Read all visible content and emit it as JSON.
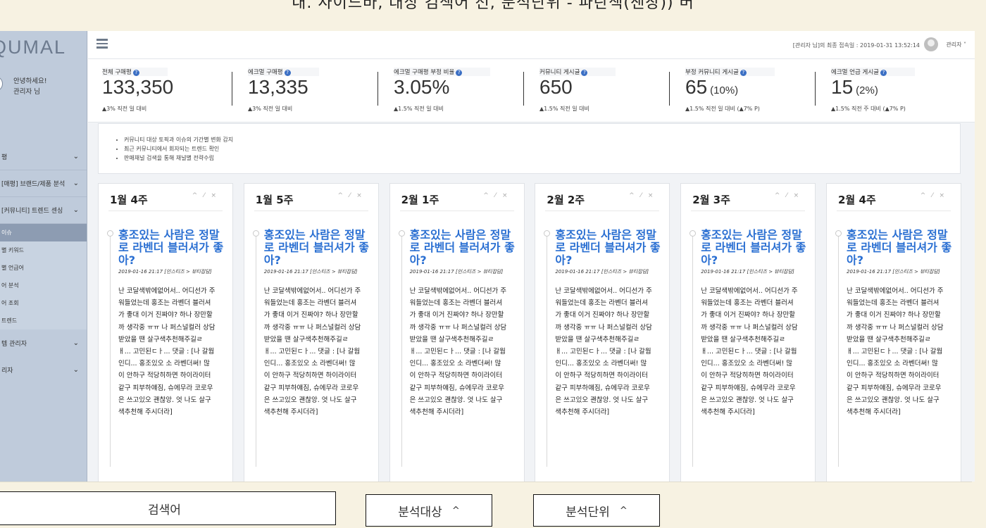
{
  "caption": "내. 사이드바, 대상 검색어 선, 분석단위 - 파란색(샌창)) 버",
  "sidebar": {
    "logo": "QUMAL",
    "greeting_line1": "안녕하세요!",
    "greeting_line2": "관리자 님",
    "menu": [
      {
        "label": "평"
      },
      {
        "label": "[매평] 브랜드/제품 분석"
      },
      {
        "label": "[커뮤니티] 트렌드 센싱"
      }
    ],
    "submenu": [
      "이슈",
      "별 키워드",
      "별 언급어",
      "어 분석",
      "어 조회",
      "트렌드"
    ],
    "menu_tail": [
      {
        "label": "템 관리자"
      },
      {
        "label": "리자"
      }
    ]
  },
  "topbar": {
    "last_login": "[관리자 님]의 최종 접속일 : 2019-01-31 13:52:14",
    "admin": "관리자 ˅"
  },
  "stats": [
    {
      "label": "전체 구매평",
      "value": "133,350",
      "pct": "",
      "sub": "▲3% 직전 일 대비"
    },
    {
      "label": "에크멀 구매평",
      "value": "13,335",
      "pct": "",
      "sub": "▲3% 직전 일 대비"
    },
    {
      "label": "에크멀 구매평 부정 비율",
      "value": "3.05%",
      "pct": "",
      "sub": "▲1.5% 직전 일 대비"
    },
    {
      "label": "커뮤니티 게시글",
      "value": "650",
      "pct": "",
      "sub": "▲1.5% 직전 일 대비"
    },
    {
      "label": "부정 커뮤니티 게시글",
      "value": "65",
      "pct": "(10%)",
      "sub": "▲1.5% 직전 일 대비 (▲7% P)"
    },
    {
      "label": "에크멀 언급 게시글",
      "value": "15",
      "pct": "(2%)",
      "sub": "▲1.5% 직전 주 대비 (▲7% P)"
    }
  ],
  "info": [
    "커뮤니티 대상 토픽과 이슈의 기간별 변화 감지",
    "최근 커뮤니티에서 회자되는 트렌드 확인",
    "판매채널 검색을 통해 채널별 전략수립"
  ],
  "card_tools": "^ ⁄ ×",
  "cards": [
    {
      "title": "1월 4주",
      "post_title": "홍조있는 사람은 정말로 라벤더 블러셔가 좋아?",
      "meta": "2019-01-16 21:17 [인스티즈 > 뷰티잡담]",
      "body": "난 코달색밖에없어서.. 어디선가 주워들었는데 홍조는 라벤더 블러셔가 좋대 이거 진짜야? 하나 장만할까 생각중 ㅠㅠ 나 퍼스널컬러 상담받았을 땐 살구색추천해주길ㄹ ㅐ... 고민된ㄷㅏ... 댓글 : [나 갈웜인디... 홍조있오 소 라벤더써! 많이 안하구 적당히하면 하이라이터 같구 피부하얘짐, 슈에무라 코로우은 쓰고있오 괜찮앙. 엇 나도 살구색추천해 주시더라]"
    },
    {
      "title": "1월 5주",
      "post_title": "홍조있는 사람은 정말로 라벤더 블러셔가 좋아?",
      "meta": "2019-01-16 21:17 [인스티즈 > 뷰티잡담]",
      "body": "난 코달색밖에없어서.. 어디선가 주워들었는데 홍조는 라벤더 블러셔가 좋대 이거 진짜야? 하나 장만할까 생각중 ㅠㅠ 나 퍼스널컬러 상담받았을 땐 살구색추천해주길ㄹ ㅐ... 고민된ㄷㅏ... 댓글 : [나 갈웜인디... 홍조있오 소 라벤더써! 많이 안하구 적당히하면 하이라이터 같구 피부하얘짐, 슈에무라 코로우은 쓰고있오 괜찮앙. 엇 나도 살구색추천해 주시더라]"
    },
    {
      "title": "2월 1주",
      "post_title": "홍조있는 사람은 정말로 라벤더 블러셔가 좋아?",
      "meta": "2019-01-16 21:17 [인스티즈 > 뷰티잡담]",
      "body": "난 코달색밖에없어서.. 어디선가 주워들었는데 홍조는 라벤더 블러셔가 좋대 이거 진짜야? 하나 장만할까 생각중 ㅠㅠ 나 퍼스널컬러 상담받았을 땐 살구색추천해주길ㄹ ㅐ... 고민된ㄷㅏ... 댓글 : [나 갈웜인디... 홍조있오 소 라벤더써! 많이 안하구 적당히하면 하이라이터 같구 피부하얘짐, 슈에무라 코로우은 쓰고있오 괜찮앙. 엇 나도 살구색추천해 주시더라]"
    },
    {
      "title": "2월 2주",
      "post_title": "홍조있는 사람은 정말로 라벤더 블러셔가 좋아?",
      "meta": "2019-01-16 21:17 [인스티즈 > 뷰티잡담]",
      "body": "난 코달색밖에없어서.. 어디선가 주워들었는데 홍조는 라벤더 블러셔가 좋대 이거 진짜야? 하나 장만할까 생각중 ㅠㅠ 나 퍼스널컬러 상담받았을 땐 살구색추천해주길ㄹ ㅐ... 고민된ㄷㅏ... 댓글 : [나 갈웜인디... 홍조있오 소 라벤더써! 많이 안하구 적당히하면 하이라이터 같구 피부하얘짐, 슈에무라 코로우은 쓰고있오 괜찮앙. 엇 나도 살구색추천해 주시더라]"
    },
    {
      "title": "2월 3주",
      "post_title": "홍조있는 사람은 정말로 라벤더 블러셔가 좋아?",
      "meta": "2019-01-16 21:17 [인스티즈 > 뷰티잡담]",
      "body": "난 코달색밖에없어서.. 어디선가 주워들었는데 홍조는 라벤더 블러셔가 좋대 이거 진짜야? 하나 장만할까 생각중 ㅠㅠ 나 퍼스널컬러 상담받았을 땐 살구색추천해주길ㄹ ㅐ... 고민된ㄷㅏ... 댓글 : [나 갈웜인디... 홍조있오 소 라벤더써! 많이 안하구 적당히하면 하이라이터 같구 피부하얘짐, 슈에무라 코로우은 쓰고있오 괜찮앙. 엇 나도 살구색추천해 주시더라]"
    },
    {
      "title": "2월 4주",
      "post_title": "홍조있는 사람은 정말로 라벤더 블러셔가 좋아?",
      "meta": "2019-01-16 21:17 [인스티즈 > 뷰티잡담]",
      "body": "난 코달색밖에없어서.. 어디선가 주워들었는데 홍조는 라벤더 블러셔가 좋대 이거 진짜야? 하나 장만할까 생각중 ㅠㅠ 나 퍼스널컬러 상담받았을 땐 살구색추천해주길ㄹ ㅐ... 고민된ㄷㅏ... 댓글 : [나 갈웜인디... 홍조있오 소 라벤더써! 많이 안하구 적당히하면 하이라이터 같구 피부하얘짐, 슈에무라 코로우은 쓰고있오 괜찮앙. 엇 나도 살구색추천해 주시더라]"
    }
  ],
  "bottom": {
    "search_label": "검색어",
    "target_label": "분석대상",
    "unit_label": "분석단위",
    "caret": "^"
  }
}
